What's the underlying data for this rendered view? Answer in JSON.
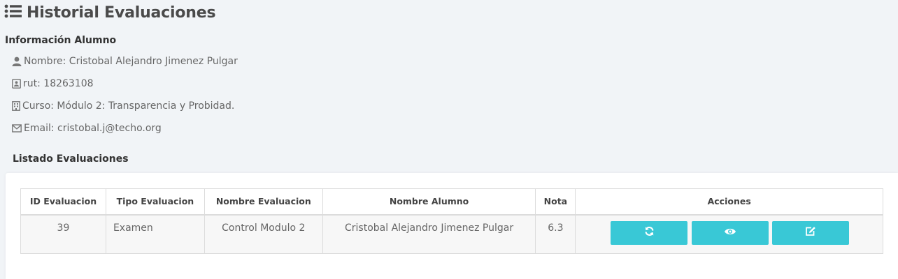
{
  "header": {
    "title": "Historial Evaluaciones",
    "icon": "list-icon"
  },
  "student_info": {
    "section_title": "Información Alumno",
    "name_line": "Nombre: Cristobal Alejandro Jimenez Pulgar",
    "rut_line": "rut: 18263108",
    "course_line": "Curso: Módulo 2: Transparencia y Probidad.",
    "email_line": "Email: cristobal.j@techo.org"
  },
  "evaluations": {
    "section_title": "Listado Evaluaciones",
    "columns": [
      "ID Evaluacion",
      "Tipo Evaluacion",
      "Nombre Evaluacion",
      "Nombre Alumno",
      "Nota",
      "Acciones"
    ],
    "rows": [
      {
        "id": "39",
        "tipo": "Examen",
        "nombre_evaluacion": "Control Modulo 2",
        "nombre_alumno": "Cristobal Alejandro Jimenez Pulgar",
        "nota": "6.3",
        "actions": [
          "refresh-icon",
          "eye-icon",
          "edit-icon"
        ]
      }
    ]
  },
  "colors": {
    "accent": "#39c8d6",
    "background": "#f1f4f7"
  }
}
